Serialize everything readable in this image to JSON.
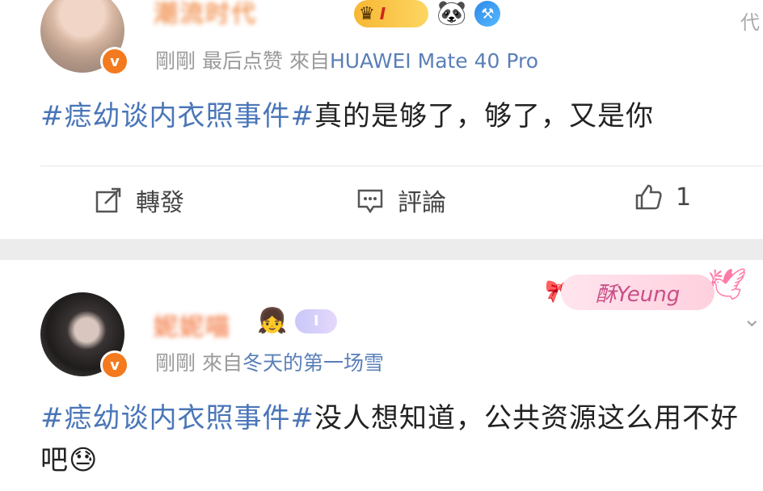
{
  "post1": {
    "username": "潮流时代",
    "badge_level": "I",
    "meta_time": "剛剛",
    "meta_action": "最后点赞",
    "meta_from_label": "來自",
    "meta_source": "HUAWEI Mate 40 Pro",
    "verified_mark": "v",
    "topic": "#痣幼谈内衣照事件#",
    "text": "真的是够了，够了，又是你",
    "actions": {
      "share_label": "轉發",
      "comment_label": "評論",
      "like_count": "1"
    },
    "corner_char": "代"
  },
  "post2": {
    "username": "妮妮喵",
    "rank_badge": "Ⅰ",
    "meta_time": "剛剛",
    "meta_from_label": "來自",
    "meta_source": "冬天的第一场雪",
    "verified_mark": "v",
    "sticker_text": "酥Yeung",
    "topic": "#痣幼谈内衣照事件#",
    "text": "没人想知道，公共资源这么用不好吧",
    "emoji": "😓"
  },
  "colors": {
    "topic": "#4a76b8",
    "source": "#5a7fb8",
    "meta": "#9a9a9a",
    "verified": "#f37a1e",
    "separator": "#ececec"
  },
  "icons": {
    "share": "share-icon",
    "comment": "comment-icon",
    "like": "thumbs-up-icon"
  }
}
